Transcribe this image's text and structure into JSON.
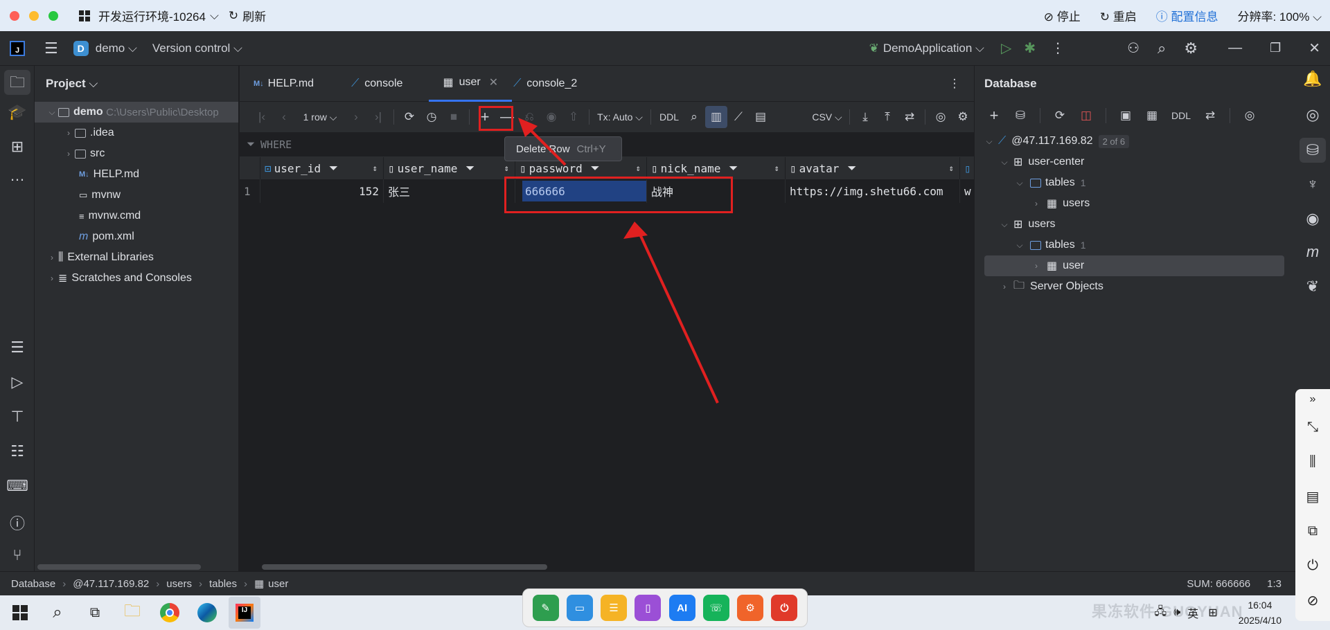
{
  "mac_bar": {
    "env_title": "开发运行环境-10264",
    "refresh": "刷新",
    "stop": "停止",
    "restart": "重启",
    "config": "配置信息",
    "resolution": "分辨率: 100%"
  },
  "ide_header": {
    "project_badge": "D",
    "project": "demo",
    "vcs": "Version control",
    "run_config": "DemoApplication"
  },
  "project_panel": {
    "title": "Project",
    "root_name": "demo",
    "root_path": "C:\\Users\\Public\\Desktop",
    "items": [
      ".idea",
      "src",
      "HELP.md",
      "mvnw",
      "mvnw.cmd",
      "pom.xml",
      "External Libraries",
      "Scratches and Consoles"
    ]
  },
  "tabs": [
    "HELP.md",
    "console",
    "user",
    "console_2"
  ],
  "db_toolbar": {
    "rows": "1 row",
    "tx": "Tx: Auto",
    "ddl": "DDL",
    "csv": "CSV"
  },
  "where_label": "WHERE",
  "grid": {
    "columns": [
      "user_id",
      "user_name",
      "password",
      "nick_name",
      "avatar"
    ],
    "rows": [
      {
        "num": "1",
        "user_id": "152",
        "user_name": "张三",
        "password": "666666",
        "nick_name": "战神",
        "avatar": "https://img.shetu66.com",
        "extra": "w"
      }
    ]
  },
  "tooltip": {
    "label": "Delete Row",
    "shortcut": "Ctrl+Y"
  },
  "database_panel": {
    "title": "Database",
    "ddl": "DDL",
    "host": "@47.117.169.82",
    "host_badge": "2 of 6",
    "schema1": "user-center",
    "tables1": "tables",
    "tables1_count": "1",
    "table1": "users",
    "schema2": "users",
    "tables2": "tables",
    "tables2_count": "1",
    "table2": "user",
    "server_objects": "Server Objects"
  },
  "status_bar": {
    "crumbs": [
      "Database",
      "@47.117.169.82",
      "users",
      "tables",
      "user"
    ],
    "sum": "SUM: 666666",
    "pos": "1:3"
  },
  "taskbar": {
    "dock_ai": "AI",
    "time": "16:04",
    "date": "2025/4/10",
    "ime": "英",
    "watermark": "果冻软件 GUOYUAN"
  },
  "colors": {
    "accent": "#3574f0",
    "annotation_red": "#e02020",
    "selection": "#214283"
  }
}
